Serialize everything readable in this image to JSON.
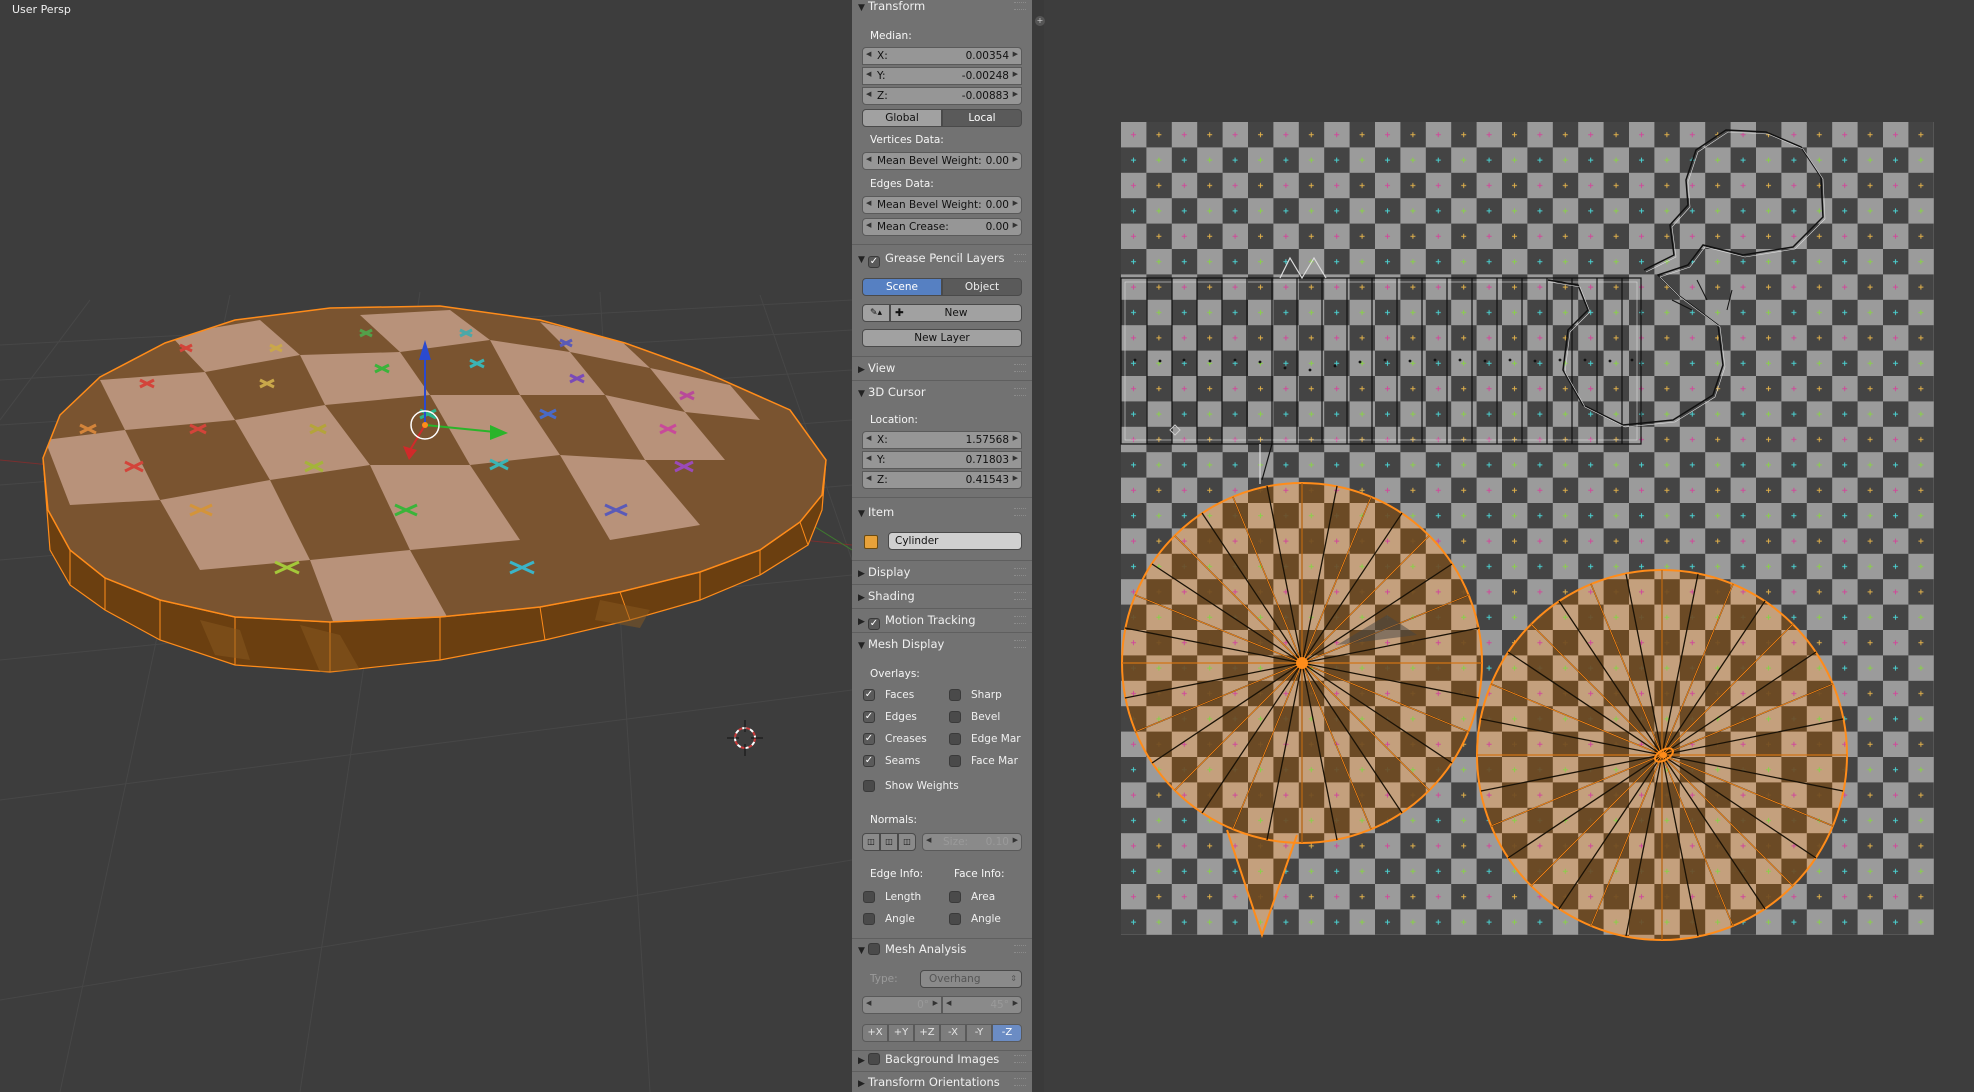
{
  "viewport": {
    "label": "User Persp"
  },
  "npanel": {
    "transform": {
      "title": "Transform",
      "median_label": "Median:",
      "median": [
        {
          "axis": "X:",
          "value": "0.00354"
        },
        {
          "axis": "Y:",
          "value": "-0.00248"
        },
        {
          "axis": "Z:",
          "value": "-0.00883"
        }
      ],
      "space": {
        "global": "Global",
        "local": "Local",
        "active": "Local"
      },
      "vertices_data_label": "Vertices Data:",
      "vertex_bevel": {
        "label": "Mean Bevel Weight:",
        "value": "0.00"
      },
      "edges_data_label": "Edges Data:",
      "edge_bevel": {
        "label": "Mean Bevel Weight:",
        "value": "0.00"
      },
      "edge_crease": {
        "label": "Mean Crease:",
        "value": "0.00"
      }
    },
    "grease_pencil": {
      "title": "Grease Pencil Layers",
      "scene": "Scene",
      "object": "Object",
      "active": "Scene",
      "new": "New",
      "new_layer": "New Layer"
    },
    "view": {
      "title": "View"
    },
    "cursor": {
      "title": "3D Cursor",
      "location_label": "Location:",
      "location": [
        {
          "axis": "X:",
          "value": "1.57568"
        },
        {
          "axis": "Y:",
          "value": "0.71803"
        },
        {
          "axis": "Z:",
          "value": "0.41543"
        }
      ]
    },
    "item": {
      "title": "Item",
      "name": "Cylinder"
    },
    "display": {
      "title": "Display"
    },
    "shading": {
      "title": "Shading"
    },
    "motion_tracking": {
      "title": "Motion Tracking"
    },
    "mesh_display": {
      "title": "Mesh Display",
      "overlays_label": "Overlays:",
      "overlays_left": [
        {
          "label": "Faces",
          "checked": true
        },
        {
          "label": "Edges",
          "checked": true
        },
        {
          "label": "Creases",
          "checked": true
        },
        {
          "label": "Seams",
          "checked": true
        }
      ],
      "overlays_right": [
        {
          "label": "Sharp",
          "checked": false
        },
        {
          "label": "Bevel",
          "checked": false
        },
        {
          "label": "Edge Mar",
          "checked": false
        },
        {
          "label": "Face Mar",
          "checked": false
        }
      ],
      "show_weights": "Show Weights",
      "normals_label": "Normals:",
      "size_label": "Size:",
      "size_value": "0.10",
      "edge_info_label": "Edge Info:",
      "face_info_label": "Face Info:",
      "edge_info": [
        "Length",
        "Angle"
      ],
      "face_info": [
        "Area",
        "Angle"
      ]
    },
    "mesh_analysis": {
      "title": "Mesh Analysis",
      "type_label": "Type:",
      "type_value": "Overhang",
      "min": "0°",
      "max": "45°",
      "axes": [
        "+X",
        "+Y",
        "+Z",
        "-X",
        "-Y",
        "-Z"
      ],
      "active_axis": "-Z"
    },
    "background_images": {
      "title": "Background Images"
    },
    "transform_orientations": {
      "title": "Transform Orientations"
    }
  },
  "colors": {
    "panel_bg": "#727272",
    "accent_blue": "#5680c2",
    "selection_orange": "#ff8c1a",
    "viewport_bg": "#3d3d3d"
  }
}
